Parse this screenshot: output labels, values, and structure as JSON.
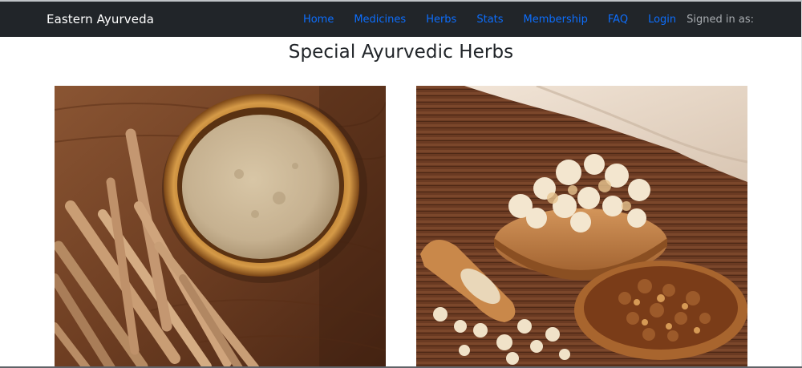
{
  "navbar": {
    "brand": "Eastern Ayurveda",
    "links": [
      "Home",
      "Medicines",
      "Herbs",
      "Stats",
      "Membership",
      "FAQ",
      "Login"
    ],
    "signed_in_label": "Signed in as:"
  },
  "page": {
    "title": "Special Ayurvedic Herbs"
  },
  "colors": {
    "navbar_bg": "#212529",
    "link": "#0d6efd",
    "title": "#212529"
  },
  "images": [
    {
      "name": "herb-image-powder-roots"
    },
    {
      "name": "herb-image-resin-bowls"
    }
  ]
}
